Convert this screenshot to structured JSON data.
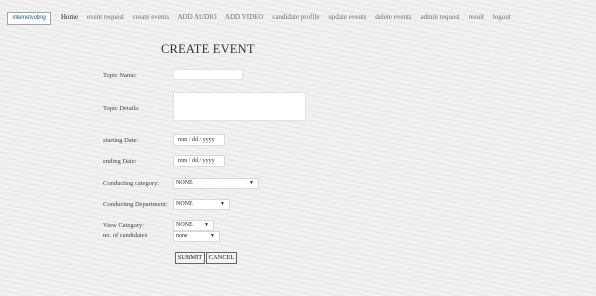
{
  "logo": {
    "text": "internetvoting"
  },
  "nav": {
    "items": [
      "Home",
      "event request",
      "create events",
      "ADD AUDIO",
      "ADD VIDEO",
      "candidate profile",
      "update events",
      "delete events",
      "admin request",
      "result",
      "logout"
    ]
  },
  "form": {
    "title": "CREATE EVENT",
    "topic_name_label": "Topic Name:",
    "topic_name_value": "",
    "topic_details_label": "Topic Details:",
    "topic_details_value": "",
    "starting_date_label": "starting Date:",
    "starting_date_placeholder": "mm / dd / yyyy",
    "ending_date_label": "ending Date:",
    "ending_date_placeholder": "mm / dd / yyyy",
    "conducting_category_label": "Conducting category:",
    "conducting_category_value": "NONE",
    "conducting_department_label": "Conducting Department:",
    "conducting_department_value": "NONE",
    "view_category_label": "View Category:",
    "view_category_value": "NONE",
    "no_of_candidates_label": "no. of candidates",
    "no_of_candidates_value": "none",
    "submit_label": "SUBMIT",
    "cancel_label": "CANCEL"
  }
}
